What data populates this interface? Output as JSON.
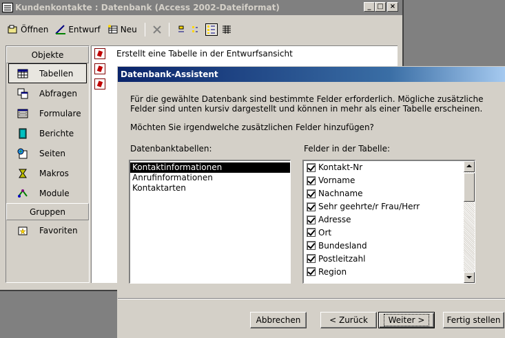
{
  "db_window": {
    "title": "Kundenkontakte : Datenbank (Access 2002-Dateiformat)",
    "caption_buttons": {
      "minimize": "_",
      "maximize": "□",
      "close": "×"
    },
    "toolbar": {
      "open_label": "Öffnen",
      "design_label": "Entwurf",
      "new_label": "Neu",
      "delete_icon": "delete-icon",
      "view_icons": [
        "large-icons-view",
        "small-icons-view",
        "list-view",
        "details-view"
      ]
    },
    "objects_header": "Objekte",
    "objects": [
      {
        "label": "Tabellen",
        "icon": "table-icon",
        "active": true
      },
      {
        "label": "Abfragen",
        "icon": "query-icon"
      },
      {
        "label": "Formulare",
        "icon": "form-icon"
      },
      {
        "label": "Berichte",
        "icon": "report-icon"
      },
      {
        "label": "Seiten",
        "icon": "page-icon"
      },
      {
        "label": "Makros",
        "icon": "macro-icon"
      },
      {
        "label": "Module",
        "icon": "module-icon"
      }
    ],
    "groups_header": "Gruppen",
    "groups": [
      {
        "label": "Favoriten",
        "icon": "favorites-icon"
      }
    ],
    "list_items": [
      {
        "label": "Erstellt eine Tabelle in der Entwurfsansicht",
        "icon": "wizard-icon"
      }
    ]
  },
  "wizard": {
    "title": "Datenbank-Assistent",
    "description": "Für die gewählte Datenbank sind bestimmte Felder erforderlich. Mögliche zusätzliche Felder sind unten kursiv dargestellt und können in mehr als einer Tabelle erscheinen.",
    "question": "Möchten Sie irgendwelche zusätzlichen Felder hinzufügen?",
    "tables_label": "Datenbanktabellen:",
    "fields_label": "Felder in der Tabelle:",
    "tables": [
      "Kontaktinformationen",
      "Anrufinformationen",
      "Kontaktarten"
    ],
    "selected_table": "Kontaktinformationen",
    "fields": [
      {
        "label": "Kontakt-Nr",
        "checked": true
      },
      {
        "label": "Vorname",
        "checked": true
      },
      {
        "label": "Nachname",
        "checked": true
      },
      {
        "label": "Sehr geehrte/r Frau/Herr",
        "checked": true
      },
      {
        "label": "Adresse",
        "checked": true
      },
      {
        "label": "Ort",
        "checked": true
      },
      {
        "label": "Bundesland",
        "checked": true
      },
      {
        "label": "Postleitzahl",
        "checked": true
      },
      {
        "label": "Region",
        "checked": true
      }
    ],
    "buttons": {
      "cancel": "Abbrechen",
      "back": "< Zurück",
      "next": "Weiter >",
      "finish": "Fertig stellen"
    }
  }
}
